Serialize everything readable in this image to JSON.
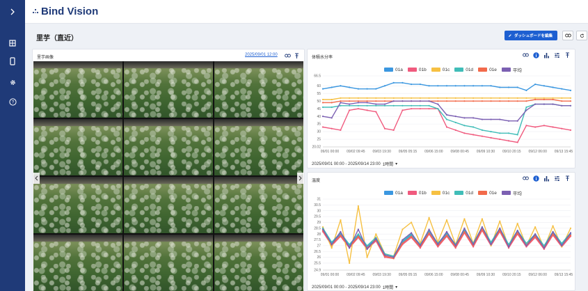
{
  "app": {
    "brand": "Bind Vision"
  },
  "page": {
    "title": "里芋（直近）",
    "edit_label": "ダッシュボードを編集"
  },
  "image_panel": {
    "title": "里芋画像",
    "timestamp": "2025/09/01 12:00",
    "photo_count": 12
  },
  "sidebar": {
    "icons": [
      "grid-icon",
      "tablet-icon",
      "gear-icon",
      "help-icon"
    ]
  },
  "colors": {
    "rail": "#1f3a78",
    "accent": "#1d5fd1"
  },
  "charts": [
    {
      "id": "moisture",
      "title": "体積水分率",
      "range": "2025/09/01 00:00 - 2025/09/14 23:00",
      "interval": "1時間",
      "chart_data": {
        "type": "line",
        "title": "体積水分率",
        "ylim": [
          20.02,
          66.5
        ],
        "yticks": [
          20.02,
          25,
          30,
          35,
          40,
          45,
          50,
          55,
          60,
          66.5
        ],
        "xtick_labels": [
          "09/01 00:00",
          "09/02 09:45",
          "09/03 19:30",
          "09/05 05:15",
          "09/06 15:00",
          "09/08 00:45",
          "09/09 10:30",
          "09/10 20:15",
          "09/12 06:00",
          "09/13 15:45"
        ],
        "x": [
          0,
          12,
          24,
          36,
          48,
          60,
          72,
          84,
          96,
          108,
          120,
          132,
          144,
          156,
          168,
          180,
          192,
          204,
          216,
          228,
          240,
          252,
          264,
          276,
          288,
          300,
          312,
          324,
          336
        ],
        "series": [
          {
            "name": "01a",
            "color": "#3b97e0",
            "values": [
              58,
              59,
              60,
              59,
              58,
              58,
              58,
              60,
              62,
              62,
              61,
              61,
              60,
              60,
              60,
              60,
              60,
              60,
              60,
              60,
              59,
              59,
              59,
              57,
              61,
              60,
              59,
              58,
              57
            ]
          },
          {
            "name": "01b",
            "color": "#f05a7e",
            "values": [
              33,
              32,
              31,
              44,
              45,
              44,
              43,
              32,
              31,
              44,
              45,
              45,
              45,
              45,
              33,
              31,
              29,
              28,
              27,
              26,
              25,
              24,
              23,
              34,
              33,
              34,
              33,
              32,
              31
            ]
          },
          {
            "name": "01c",
            "color": "#f6c042",
            "values": [
              51,
              51,
              52,
              52,
              52,
              52,
              52,
              52,
              52,
              52,
              52,
              52,
              52,
              52,
              52,
              52,
              52,
              52,
              52,
              52,
              52,
              52,
              52,
              52,
              52,
              52,
              52,
              52,
              52
            ]
          },
          {
            "name": "01d",
            "color": "#40bdb8",
            "values": [
              46,
              46,
              47,
              47,
              47,
              47,
              47,
              47,
              47,
              47,
              47,
              47,
              47,
              45,
              38,
              36,
              34,
              33,
              31,
              30,
              29,
              29,
              28,
              46,
              48,
              48,
              48,
              47,
              47
            ]
          },
          {
            "name": "01e",
            "color": "#f26a4b",
            "values": [
              49,
              49,
              50,
              50,
              50,
              50,
              50,
              50,
              50,
              50,
              50,
              50,
              50,
              50,
              50,
              50,
              50,
              50,
              50,
              50,
              50,
              50,
              50,
              50,
              51,
              51,
              51,
              50,
              50
            ]
          },
          {
            "name": "平均",
            "color": "#7b5fb2",
            "values": [
              40,
              39,
              49,
              48,
              49,
              49,
              48,
              48,
              50,
              50,
              50,
              50,
              50,
              48,
              41,
              40,
              39,
              39,
              38,
              38,
              38,
              37,
              37,
              44,
              48,
              48,
              48,
              47,
              47
            ]
          }
        ]
      }
    },
    {
      "id": "temperature",
      "title": "温度",
      "range": "2025/09/01 00:00 - 2025/09/14 23:00",
      "interval": "1時間",
      "chart_data": {
        "type": "line",
        "title": "温度",
        "ylim": [
          24.9,
          31.0
        ],
        "yticks": [
          24.9,
          25.5,
          26.0,
          26.5,
          27.0,
          27.5,
          28.0,
          28.5,
          29.0,
          29.5,
          30.0,
          30.5,
          31.0
        ],
        "xtick_labels": [
          "09/01 00:00",
          "09/02 09:45",
          "09/03 19:30",
          "09/05 05:15",
          "09/06 15:00",
          "09/08 00:45",
          "09/09 10:30",
          "09/10 20:15",
          "09/12 06:00",
          "09/13 15:45"
        ],
        "x": [
          0,
          12,
          24,
          36,
          48,
          60,
          72,
          84,
          96,
          108,
          120,
          132,
          144,
          156,
          168,
          180,
          192,
          204,
          216,
          228,
          240,
          252,
          264,
          276,
          288,
          300,
          312,
          324,
          336
        ],
        "series": [
          {
            "name": "01a",
            "color": "#3b97e0",
            "values": [
              28.4,
              27.2,
              28.0,
              27.0,
              27.9,
              26.9,
              27.6,
              26.2,
              26.0,
              27.3,
              27.9,
              27.0,
              28.2,
              27.1,
              28.0,
              27.0,
              28.3,
              27.1,
              28.5,
              27.2,
              28.4,
              27.0,
              28.2,
              27.1,
              27.9,
              26.9,
              28.1,
              27.1,
              28.0
            ]
          },
          {
            "name": "01b",
            "color": "#f05a7e",
            "values": [
              28.2,
              27.0,
              27.8,
              26.8,
              27.7,
              26.7,
              27.4,
              26.0,
              25.9,
              27.1,
              27.7,
              26.8,
              28.0,
              26.9,
              27.8,
              26.8,
              28.1,
              26.9,
              28.3,
              27.0,
              28.2,
              26.8,
              28.0,
              26.9,
              27.7,
              26.7,
              27.9,
              26.9,
              27.8
            ]
          },
          {
            "name": "01c",
            "color": "#f6c042",
            "values": [
              28.6,
              26.8,
              29.2,
              25.5,
              30.4,
              26.0,
              28.0,
              26.3,
              26.1,
              28.4,
              29.0,
              27.2,
              29.4,
              27.3,
              29.2,
              27.1,
              29.3,
              27.2,
              29.3,
              27.0,
              29.1,
              26.9,
              28.9,
              27.0,
              28.6,
              26.8,
              28.7,
              26.9,
              28.5
            ]
          },
          {
            "name": "01d",
            "color": "#40bdb8",
            "values": [
              28.5,
              27.3,
              28.1,
              27.1,
              28.0,
              27.0,
              27.7,
              26.3,
              26.1,
              27.4,
              28.0,
              27.1,
              28.3,
              27.2,
              28.1,
              27.1,
              28.4,
              27.2,
              28.6,
              27.3,
              28.5,
              27.1,
              28.3,
              27.2,
              28.0,
              27.0,
              28.2,
              27.2,
              28.1
            ]
          },
          {
            "name": "01e",
            "color": "#f26a4b",
            "values": [
              28.3,
              27.1,
              27.9,
              26.9,
              27.8,
              26.8,
              27.5,
              26.1,
              25.9,
              27.2,
              27.8,
              26.9,
              28.1,
              27.0,
              27.9,
              26.9,
              28.2,
              27.0,
              28.4,
              27.1,
              28.3,
              26.9,
              28.1,
              27.0,
              27.8,
              26.8,
              28.0,
              27.0,
              27.9
            ]
          },
          {
            "name": "平均",
            "color": "#7b5fb2",
            "values": [
              28.4,
              27.1,
              28.2,
              26.8,
              28.4,
              26.7,
              27.6,
              26.2,
              26.0,
              27.5,
              28.1,
              27.0,
              28.4,
              27.1,
              28.2,
              27.0,
              28.5,
              27.1,
              28.6,
              27.1,
              28.5,
              26.9,
              28.3,
              27.0,
              28.0,
              26.8,
              28.2,
              27.0,
              28.1
            ]
          }
        ]
      }
    }
  ]
}
